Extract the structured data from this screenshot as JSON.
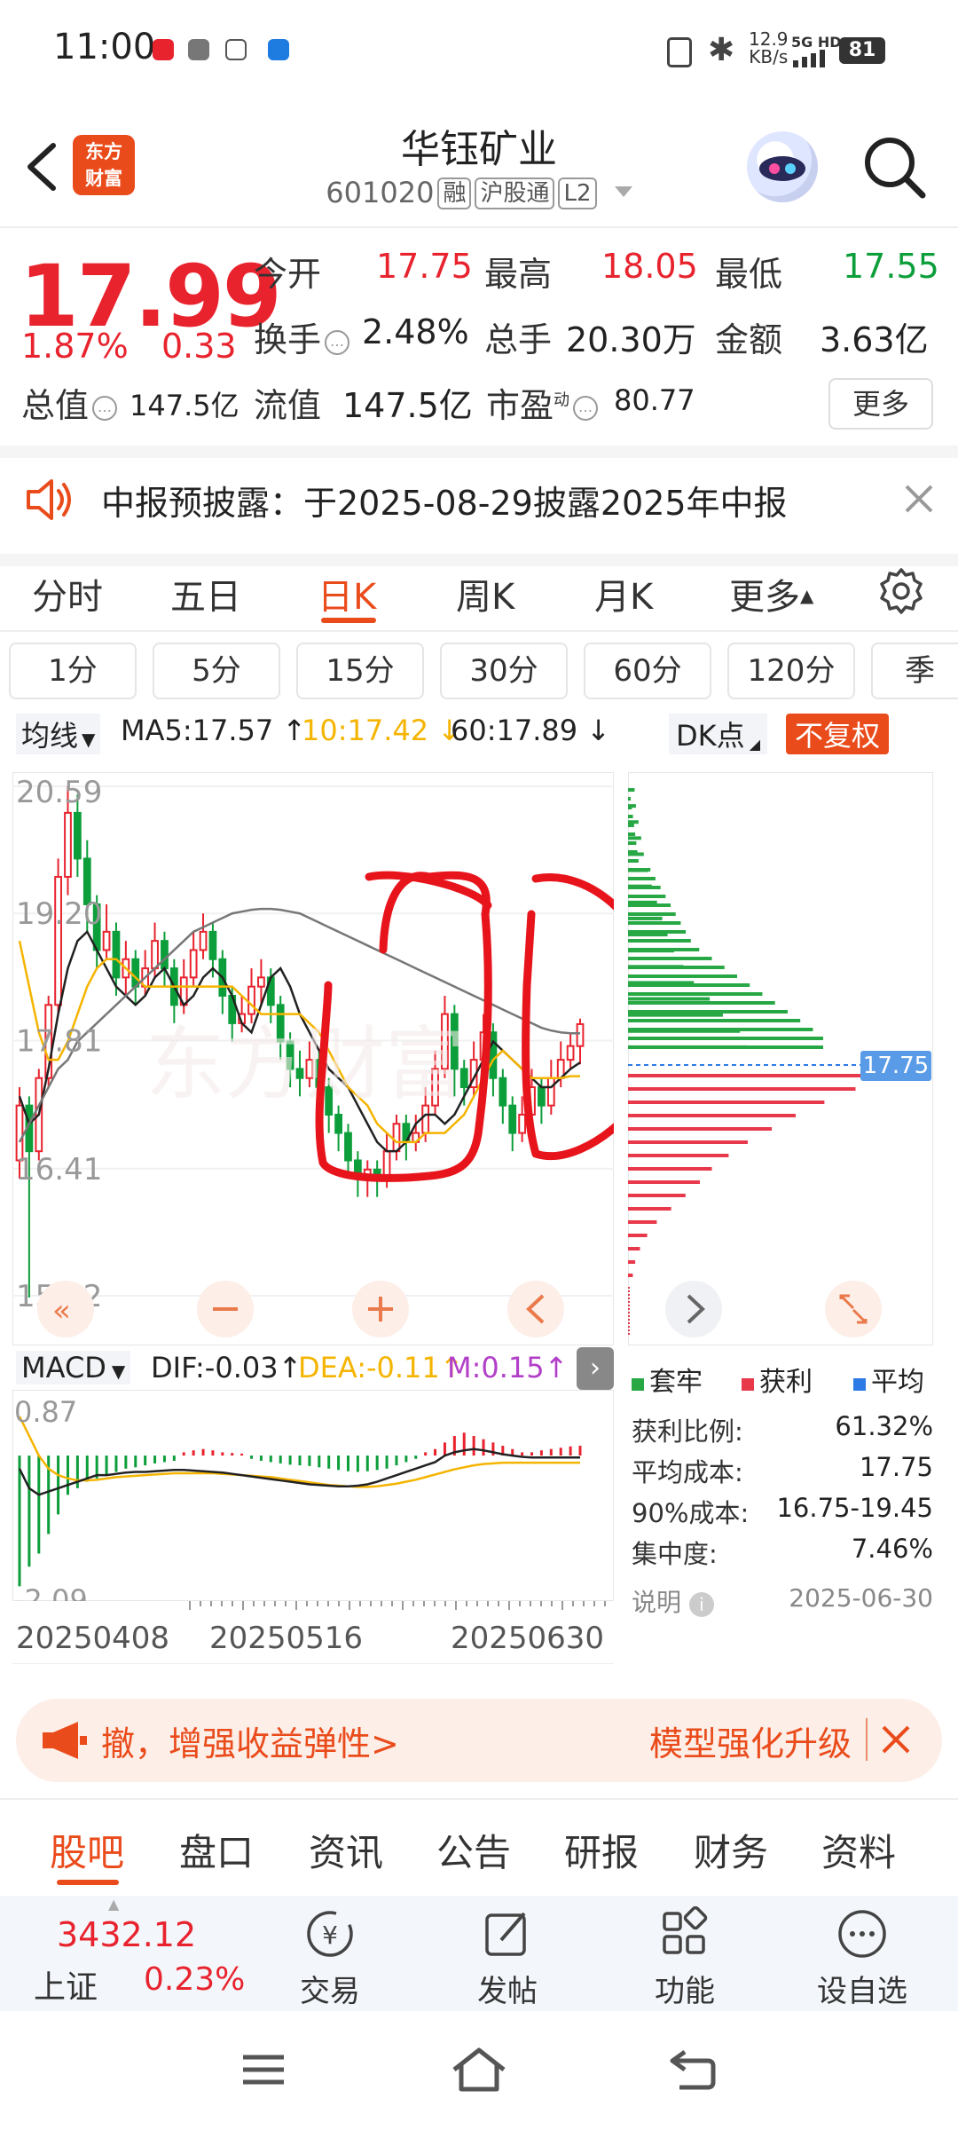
{
  "status_bar": {
    "time": "11:00",
    "net_speed": "12.9",
    "net_unit": "KB/s",
    "signal": "5G HD",
    "battery": "81"
  },
  "header": {
    "stock_name": "华钰矿业",
    "stock_code": "601020",
    "tags": [
      "融",
      "沪股通",
      "L2"
    ],
    "brand_line1": "东方",
    "brand_line2": "财富"
  },
  "quote": {
    "price": "17.99",
    "change_pct": "1.87%",
    "change": "0.33",
    "stats": [
      {
        "label": "今开",
        "value": "17.75",
        "color": "#e8232e"
      },
      {
        "label": "最高",
        "value": "18.05",
        "color": "#e8232e"
      },
      {
        "label": "最低",
        "value": "17.55",
        "color": "#0c9e3a"
      },
      {
        "label": "换手",
        "value": "2.48%",
        "color": "#222"
      },
      {
        "label": "总手",
        "value": "20.30万",
        "color": "#222"
      },
      {
        "label": "金额",
        "value": "3.63亿",
        "color": "#222"
      },
      {
        "label": "总值",
        "value": "147.5亿",
        "color": "#222"
      },
      {
        "label": "流值",
        "value": "147.5亿",
        "color": "#222"
      },
      {
        "label": "市盈",
        "value": "80.77",
        "color": "#222"
      }
    ],
    "pe_superscript": "动",
    "more_label": "更多"
  },
  "banner": {
    "text": "中报预披露：于2025-08-29披露2025年中报"
  },
  "tabs": [
    "分时",
    "五日",
    "日K",
    "周K",
    "月K",
    "更多"
  ],
  "active_tab": "日K",
  "periods": [
    "1分",
    "5分",
    "15分",
    "30分",
    "60分",
    "120分",
    "季"
  ],
  "ma_bar": {
    "selector": "均线",
    "ma5": "MA5:17.57",
    "ma10": "10:17.42",
    "ma60": "60:17.89",
    "dk_label": "DK点",
    "adjust_label": "不复权",
    "colors": {
      "ma5": "#222222",
      "ma10": "#f5b400",
      "ma60": "#777777"
    }
  },
  "chart_data": {
    "type": "candlestick",
    "y_ticks": [
      "20.59",
      "19.20",
      "17.81",
      "16.41",
      "15.02"
    ],
    "ylim": [
      15.02,
      20.59
    ],
    "x_ticks": [
      "20250408",
      "20250516",
      "20250630"
    ],
    "last_price_label": "17.75",
    "ma_lines": [
      {
        "name": "MA5",
        "color": "#222222",
        "values": [
          17.2,
          16.9,
          17.0,
          17.5,
          18.1,
          18.6,
          18.9,
          19.0,
          18.8,
          18.6,
          18.4,
          18.3,
          18.2,
          18.3,
          18.5,
          18.6,
          18.4,
          18.2,
          18.3,
          18.5,
          18.6,
          18.5,
          18.3,
          18.0,
          17.9,
          18.2,
          18.5,
          18.6,
          18.4,
          18.1,
          17.9,
          17.7,
          17.5,
          17.4,
          17.3,
          17.1,
          16.9,
          16.7,
          16.6,
          16.6,
          16.7,
          16.9,
          17.0,
          17.0,
          16.9,
          17.0,
          17.2,
          17.4,
          17.6,
          17.8,
          17.7,
          17.6,
          17.5,
          17.4,
          17.3,
          17.3,
          17.4,
          17.5,
          17.57
        ]
      },
      {
        "name": "MA10",
        "color": "#f5b400",
        "values": [
          18.9,
          18.4,
          17.9,
          17.6,
          17.6,
          17.8,
          18.1,
          18.4,
          18.6,
          18.7,
          18.7,
          18.6,
          18.5,
          18.4,
          18.4,
          18.4,
          18.4,
          18.4,
          18.4,
          18.4,
          18.4,
          18.4,
          18.4,
          18.3,
          18.2,
          18.1,
          18.1,
          18.1,
          18.1,
          18.1,
          18.0,
          17.9,
          17.7,
          17.5,
          17.3,
          17.2,
          17.1,
          16.9,
          16.8,
          16.7,
          16.7,
          16.7,
          16.8,
          16.8,
          16.8,
          16.9,
          17.0,
          17.2,
          17.4,
          17.6,
          17.7,
          17.6,
          17.5,
          17.4,
          17.4,
          17.4,
          17.4,
          17.42,
          17.42
        ]
      },
      {
        "name": "MA60",
        "color": "#777777",
        "values": [
          16.7,
          16.9,
          17.1,
          17.3,
          17.5,
          17.6,
          17.8,
          17.9,
          18.0,
          18.1,
          18.2,
          18.3,
          18.4,
          18.5,
          18.6,
          18.7,
          18.8,
          18.9,
          19.0,
          19.05,
          19.1,
          19.15,
          19.2,
          19.22,
          19.24,
          19.25,
          19.25,
          19.24,
          19.22,
          19.2,
          19.15,
          19.1,
          19.05,
          19.0,
          18.95,
          18.9,
          18.85,
          18.8,
          18.75,
          18.7,
          18.65,
          18.6,
          18.55,
          18.5,
          18.45,
          18.4,
          18.35,
          18.3,
          18.25,
          18.2,
          18.15,
          18.1,
          18.05,
          18.0,
          17.95,
          17.92,
          17.9,
          17.89,
          17.89
        ]
      }
    ],
    "candles": [
      [
        16.5,
        17.1,
        17.3,
        16.3
      ],
      [
        17.1,
        16.6,
        17.2,
        15.0
      ],
      [
        16.6,
        17.4,
        17.5,
        16.5
      ],
      [
        17.4,
        18.2,
        18.3,
        17.3
      ],
      [
        18.2,
        19.6,
        19.8,
        18.1
      ],
      [
        19.6,
        20.3,
        20.59,
        19.4
      ],
      [
        20.3,
        19.8,
        20.5,
        19.6
      ],
      [
        19.8,
        19.3,
        20.0,
        19.0
      ],
      [
        19.3,
        18.8,
        19.4,
        18.6
      ],
      [
        18.8,
        19.0,
        19.3,
        18.7
      ],
      [
        19.0,
        18.5,
        19.1,
        18.3
      ],
      [
        18.5,
        18.7,
        18.9,
        18.3
      ],
      [
        18.7,
        18.4,
        18.8,
        18.2
      ],
      [
        18.4,
        18.6,
        18.8,
        18.3
      ],
      [
        18.6,
        18.9,
        19.1,
        18.5
      ],
      [
        18.9,
        18.6,
        19.0,
        18.4
      ],
      [
        18.6,
        18.2,
        18.7,
        18.0
      ],
      [
        18.2,
        18.5,
        18.7,
        18.1
      ],
      [
        18.5,
        18.8,
        19.0,
        18.4
      ],
      [
        18.8,
        19.0,
        19.2,
        18.7
      ],
      [
        19.0,
        18.7,
        19.1,
        18.5
      ],
      [
        18.7,
        18.3,
        18.8,
        18.1
      ],
      [
        18.3,
        18.0,
        18.4,
        17.8
      ],
      [
        18.0,
        18.1,
        18.3,
        17.9
      ],
      [
        18.1,
        18.4,
        18.6,
        18.0
      ],
      [
        18.4,
        18.5,
        18.7,
        18.2
      ],
      [
        18.5,
        18.2,
        18.6,
        18.0
      ],
      [
        18.2,
        17.8,
        18.3,
        17.6
      ],
      [
        17.8,
        17.5,
        17.9,
        17.3
      ],
      [
        17.5,
        17.4,
        17.7,
        17.2
      ],
      [
        17.4,
        17.6,
        17.8,
        17.3
      ],
      [
        17.6,
        17.3,
        17.7,
        17.1
      ],
      [
        17.3,
        17.0,
        17.4,
        16.8
      ],
      [
        17.0,
        16.8,
        17.1,
        16.6
      ],
      [
        16.8,
        16.5,
        16.9,
        16.3
      ],
      [
        16.5,
        16.3,
        16.6,
        16.1
      ],
      [
        16.3,
        16.4,
        16.5,
        16.1
      ],
      [
        16.4,
        16.3,
        16.5,
        16.1
      ],
      [
        16.3,
        16.6,
        16.8,
        16.2
      ],
      [
        16.6,
        16.9,
        17.0,
        16.5
      ],
      [
        16.9,
        16.7,
        17.0,
        16.5
      ],
      [
        16.7,
        16.8,
        17.0,
        16.6
      ],
      [
        16.8,
        17.1,
        17.3,
        16.7
      ],
      [
        17.1,
        17.5,
        17.7,
        17.0
      ],
      [
        17.5,
        18.1,
        18.3,
        17.4
      ],
      [
        18.1,
        17.5,
        18.2,
        17.2
      ],
      [
        17.5,
        17.3,
        17.6,
        17.1
      ],
      [
        17.3,
        17.6,
        17.8,
        17.2
      ],
      [
        17.6,
        17.9,
        18.1,
        17.5
      ],
      [
        17.9,
        17.4,
        18.0,
        17.2
      ],
      [
        17.4,
        17.1,
        17.5,
        16.9
      ],
      [
        17.1,
        16.8,
        17.2,
        16.6
      ],
      [
        16.8,
        17.0,
        17.2,
        16.7
      ],
      [
        17.0,
        17.3,
        17.5,
        16.9
      ],
      [
        17.3,
        17.1,
        17.4,
        16.9
      ],
      [
        17.1,
        17.4,
        17.6,
        17.0
      ],
      [
        17.4,
        17.6,
        17.8,
        17.3
      ],
      [
        17.6,
        17.75,
        17.9,
        17.5
      ],
      [
        17.75,
        17.99,
        18.05,
        17.55
      ]
    ]
  },
  "macd": {
    "selector": "MACD",
    "dif": "DIF:-0.03",
    "dea": "DEA:-0.11",
    "m": "M:0.15",
    "y_ticks": [
      "0.87",
      "-2.09"
    ],
    "ylim": [
      -2.09,
      0.87
    ],
    "hist": [
      -2.0,
      -1.7,
      -1.5,
      -1.2,
      -0.9,
      -0.6,
      -0.5,
      -0.4,
      -0.35,
      -0.3,
      -0.25,
      -0.2,
      -0.18,
      -0.15,
      -0.12,
      -0.1,
      -0.08,
      0.05,
      0.08,
      0.1,
      0.08,
      0.05,
      0.04,
      0.03,
      -0.05,
      -0.08,
      -0.1,
      -0.12,
      -0.14,
      -0.15,
      -0.16,
      -0.18,
      -0.2,
      -0.22,
      -0.24,
      -0.25,
      -0.24,
      -0.22,
      -0.2,
      -0.15,
      -0.1,
      -0.05,
      0.05,
      0.1,
      0.2,
      0.3,
      0.35,
      0.3,
      0.25,
      0.2,
      0.15,
      0.1,
      0.05,
      0.05,
      0.08,
      0.1,
      0.12,
      0.14,
      0.15
    ],
    "dif_line": [
      -0.2,
      -0.5,
      -0.6,
      -0.55,
      -0.5,
      -0.45,
      -0.4,
      -0.35,
      -0.3,
      -0.3,
      -0.28,
      -0.26,
      -0.25,
      -0.25,
      -0.24,
      -0.23,
      -0.22,
      -0.22,
      -0.23,
      -0.24,
      -0.25,
      -0.26,
      -0.28,
      -0.3,
      -0.32,
      -0.34,
      -0.36,
      -0.38,
      -0.4,
      -0.42,
      -0.44,
      -0.45,
      -0.46,
      -0.47,
      -0.47,
      -0.46,
      -0.44,
      -0.4,
      -0.35,
      -0.3,
      -0.25,
      -0.2,
      -0.15,
      -0.1,
      0.0,
      0.05,
      0.08,
      0.1,
      0.08,
      0.05,
      0.02,
      0.0,
      -0.02,
      -0.03,
      -0.03,
      -0.03,
      -0.03,
      -0.03,
      -0.03
    ],
    "dea_line": [
      0.6,
      0.3,
      0.0,
      -0.2,
      -0.3,
      -0.35,
      -0.38,
      -0.38,
      -0.37,
      -0.35,
      -0.33,
      -0.32,
      -0.31,
      -0.3,
      -0.29,
      -0.28,
      -0.27,
      -0.27,
      -0.27,
      -0.27,
      -0.27,
      -0.28,
      -0.29,
      -0.3,
      -0.31,
      -0.32,
      -0.33,
      -0.35,
      -0.37,
      -0.39,
      -0.41,
      -0.43,
      -0.45,
      -0.46,
      -0.47,
      -0.48,
      -0.48,
      -0.47,
      -0.45,
      -0.43,
      -0.4,
      -0.37,
      -0.33,
      -0.29,
      -0.25,
      -0.21,
      -0.18,
      -0.15,
      -0.13,
      -0.12,
      -0.11,
      -0.11,
      -0.11,
      -0.11,
      -0.11,
      -0.11,
      -0.11,
      -0.11,
      -0.11
    ]
  },
  "distribution": {
    "current_label": "17.75",
    "legend": [
      {
        "label": "套牢",
        "color": "#27a845"
      },
      {
        "label": "获利",
        "color": "#e8394b"
      },
      {
        "label": "平均",
        "color": "#2d7be5"
      }
    ],
    "stats": [
      {
        "label": "获利比例:",
        "value": "61.32%"
      },
      {
        "label": "平均成本:",
        "value": "17.75"
      },
      {
        "label": "90%成本:",
        "value": "16.75-19.45"
      },
      {
        "label": "集中度:",
        "value": "7.46%"
      }
    ],
    "note_label": "说明",
    "note_date": "2025-06-30",
    "green_bars": [
      0.05,
      0.06,
      0.08,
      0.1,
      0.12,
      0.15,
      0.18,
      0.22,
      0.26,
      0.3,
      0.35,
      0.42,
      0.5,
      0.62,
      0.72,
      0.85,
      0.9
    ],
    "red_bars": [
      1.0,
      0.95,
      0.82,
      0.7,
      0.6,
      0.5,
      0.42,
      0.35,
      0.3,
      0.24,
      0.18,
      0.12,
      0.08,
      0.05,
      0.03,
      0.02
    ]
  },
  "promo": {
    "text": "撤，增强收益弹性>",
    "right_text": "模型强化升级"
  },
  "subtabs": [
    "股吧",
    "盘口",
    "资讯",
    "公告",
    "研报",
    "财务",
    "资料"
  ],
  "active_subtab": "股吧",
  "toolbar": {
    "index_value": "3432.12",
    "index_name": "上证",
    "index_pct": "0.23%",
    "items": [
      "交易",
      "发帖",
      "功能",
      "设自选"
    ]
  }
}
